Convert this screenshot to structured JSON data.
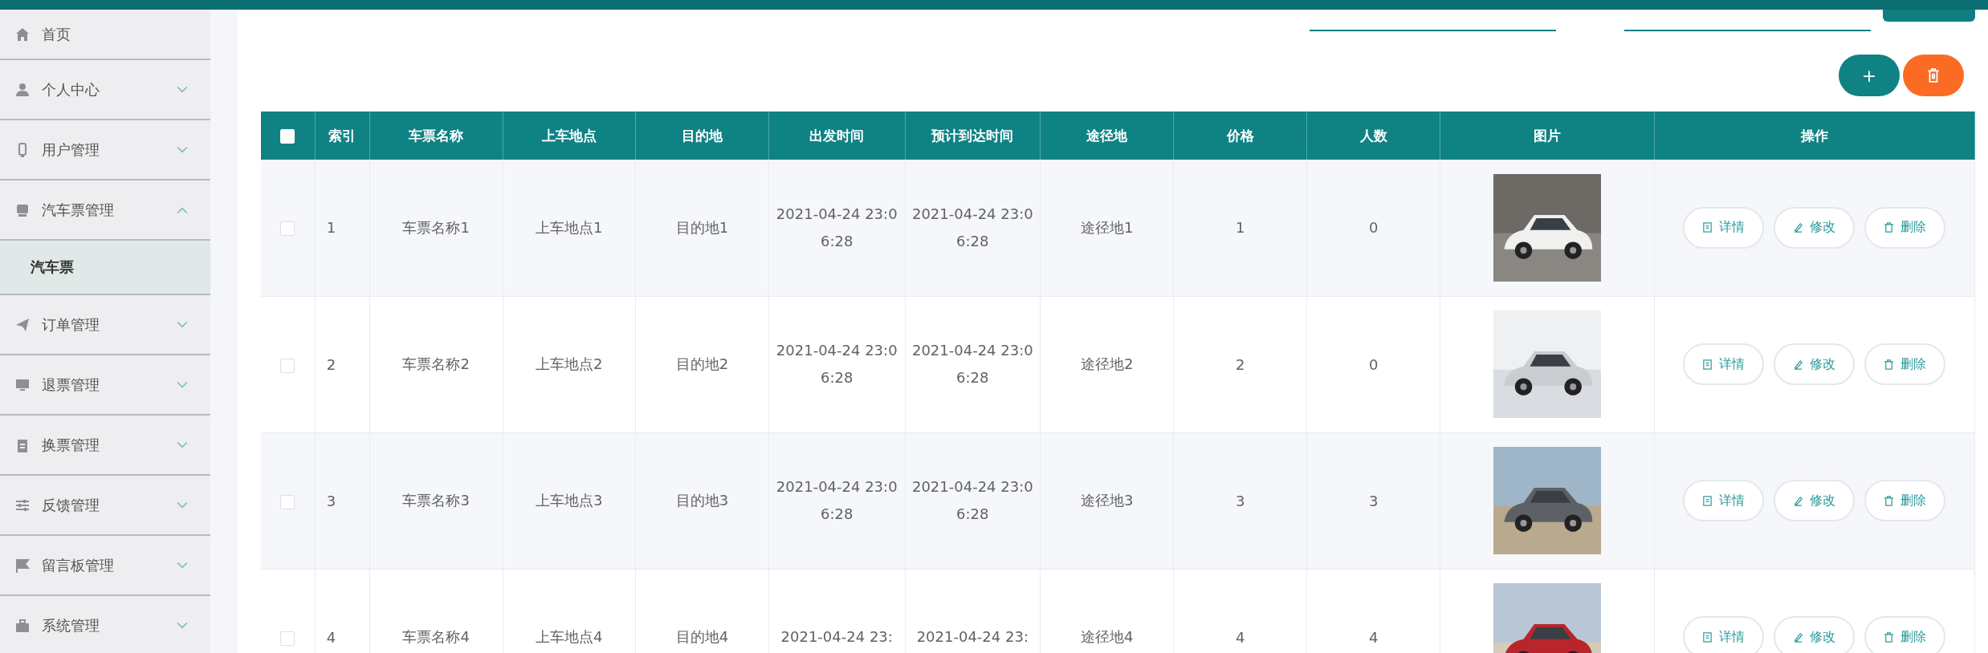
{
  "sidebar": {
    "items": [
      {
        "label": "首页"
      },
      {
        "label": "个人中心",
        "expanded": false
      },
      {
        "label": "用户管理",
        "expanded": false
      },
      {
        "label": "汽车票管理",
        "expanded": true,
        "children": [
          {
            "label": "汽车票",
            "selected": true
          }
        ]
      },
      {
        "label": "订单管理",
        "expanded": false
      },
      {
        "label": "退票管理",
        "expanded": false
      },
      {
        "label": "换票管理",
        "expanded": false
      },
      {
        "label": "反馈管理",
        "expanded": false
      },
      {
        "label": "留言板管理",
        "expanded": false
      },
      {
        "label": "系统管理",
        "expanded": false
      }
    ]
  },
  "toolbar": {
    "add_label": "+"
  },
  "table": {
    "header_checked": false,
    "columns": [
      "索引",
      "车票名称",
      "上车地点",
      "目的地",
      "出发时间",
      "预计到达时间",
      "途径地",
      "价格",
      "人数",
      "图片",
      "操作"
    ],
    "rows": [
      {
        "checked": false,
        "cells": [
          "1",
          "车票名称1",
          "上车地点1",
          "目的地1",
          "2021-04-24 23:06:28",
          "2021-04-24 23:06:28",
          "途径地1",
          "1",
          "0"
        ],
        "image": {
          "kind": "picture"
        },
        "actions": [
          "详情",
          "修改",
          "删除"
        ]
      },
      {
        "checked": false,
        "cells": [
          "2",
          "车票名称2",
          "上车地点2",
          "目的地2",
          "2021-04-24 23:06:28",
          "2021-04-24 23:06:28",
          "途径地2",
          "2",
          "0"
        ],
        "image": {
          "kind": "picture"
        },
        "actions": [
          "详情",
          "修改",
          "删除"
        ]
      },
      {
        "checked": false,
        "cells": [
          "3",
          "车票名称3",
          "上车地点3",
          "目的地3",
          "2021-04-24 23:06:28",
          "2021-04-24 23:06:28",
          "途径地3",
          "3",
          "3"
        ],
        "image": {
          "kind": "picture"
        },
        "actions": [
          "详情",
          "修改",
          "删除"
        ]
      },
      {
        "checked": false,
        "cells": [
          "4",
          "车票名称4",
          "上车地点4",
          "目的地4",
          "2021-04-24 23:",
          "2021-04-24 23:",
          "途径地4",
          "4",
          "4"
        ],
        "image": {
          "kind": "picture"
        },
        "actions": [
          "详情",
          "修改",
          "删除"
        ]
      }
    ]
  }
}
